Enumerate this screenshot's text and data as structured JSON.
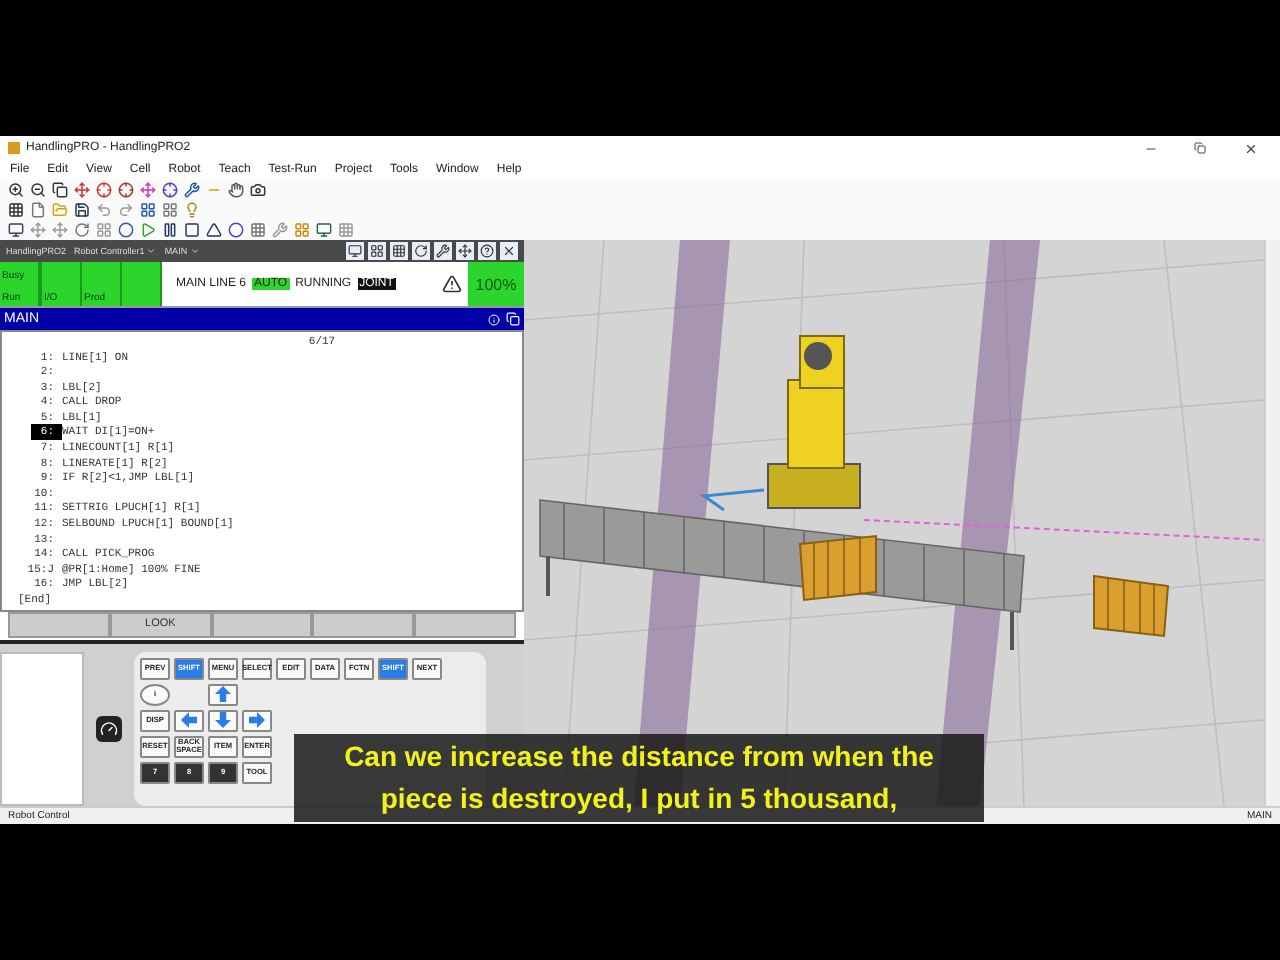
{
  "window": {
    "title": "HandlingPRO - HandlingPRO2"
  },
  "menu": [
    "File",
    "Edit",
    "View",
    "Cell",
    "Robot",
    "Teach",
    "Test-Run",
    "Project",
    "Tools",
    "Window",
    "Help"
  ],
  "pendant": {
    "breadcrumb": [
      {
        "label": "HandlingPRO2",
        "dropdown": false
      },
      {
        "label": "Robot Controller1",
        "dropdown": true
      },
      {
        "label": "MAIN",
        "dropdown": true
      }
    ],
    "indicators": [
      {
        "label": "Busy",
        "on": true
      },
      {
        "label": "Run",
        "on": true
      },
      {
        "label": "I/O",
        "on": true
      },
      {
        "label": "Prod",
        "on": true
      }
    ],
    "status": [
      {
        "text": "MAIN LINE 6",
        "kind": "plain"
      },
      {
        "text": "AUTO",
        "kind": "highlight"
      },
      {
        "text": "RUNNING",
        "kind": "plain"
      },
      {
        "text": "JOINT",
        "kind": "inverse"
      }
    ],
    "override": "100%",
    "screen_title": "MAIN",
    "position": "6/17",
    "lines": [
      {
        "num": "1:",
        "code": "LINE[1] ON",
        "selected": false
      },
      {
        "num": "2:",
        "selected": false
      },
      {
        "num": "3:",
        "code": "LBL[2]",
        "selected": false
      },
      {
        "num": "4:",
        "code": "CALL DROP",
        "selected": false
      },
      {
        "num": "5:",
        "code": "LBL[1]",
        "selected": false
      },
      {
        "num": "6:",
        "code": "WAIT DI[1]=ON+",
        "selected": true
      },
      {
        "num": "7:",
        "code": "LINECOUNT[1] R[1]",
        "selected": false
      },
      {
        "num": "8:",
        "code": "LINERATE[1] R[2]",
        "selected": false
      },
      {
        "num": "9:",
        "code": "IF R[2]<1,JMP LBL[1]",
        "selected": false
      },
      {
        "num": "10:",
        "selected": false
      },
      {
        "num": "11:",
        "code": "SETTRIG LPUCH[1] R[1]",
        "selected": false
      },
      {
        "num": "12:",
        "code": "SELBOUND LPUCH[1] BOUND[1]",
        "selected": false
      },
      {
        "num": "13:",
        "selected": false
      },
      {
        "num": "14:",
        "code": "CALL PICK_PROG",
        "selected": false
      },
      {
        "num": "15:J",
        "code": "@PR[1:Home] 100% FINE",
        "selected": false
      },
      {
        "num": "16:",
        "code": "JMP LBL[2]",
        "selected": false
      }
    ],
    "end_marker": "[End]",
    "function_keys": [
      "LOOK"
    ]
  },
  "keypad": {
    "top_row": [
      {
        "label": "PREV",
        "accent": false
      },
      {
        "label": "SHIFT",
        "accent": true
      },
      {
        "label": "MENU",
        "accent": false
      },
      {
        "label": "SELECT",
        "accent": false
      },
      {
        "label": "EDIT",
        "accent": false
      },
      {
        "label": "DATA",
        "accent": false
      },
      {
        "label": "FCTN",
        "accent": false
      },
      {
        "label": "SHIFT",
        "accent": true
      },
      {
        "label": "NEXT",
        "accent": false
      }
    ],
    "rows": [
      [
        {
          "kind": "round",
          "label": "i"
        },
        {
          "kind": "gap"
        },
        {
          "kind": "up"
        },
        {
          "kind": "gap"
        }
      ],
      [
        {
          "kind": "key",
          "label": "DISP"
        },
        {
          "kind": "left"
        },
        {
          "kind": "down"
        },
        {
          "kind": "right"
        }
      ],
      [
        {
          "kind": "key",
          "label": "RESET"
        },
        {
          "kind": "key",
          "label": "BACK SPACE"
        },
        {
          "kind": "key",
          "label": "ITEM"
        },
        {
          "kind": "key",
          "label": "ENTER"
        }
      ],
      [
        {
          "kind": "dark",
          "label": "7"
        },
        {
          "kind": "dark",
          "label": "8"
        },
        {
          "kind": "dark",
          "label": "9"
        },
        {
          "kind": "key",
          "label": "TOOL"
        }
      ]
    ]
  },
  "status_bar": {
    "left": "Robot Control",
    "right": "MAIN"
  },
  "subtitle": {
    "lines": [
      "Can we increase the distance from when the",
      "piece is destroyed, I put in 5 thousand,"
    ]
  }
}
